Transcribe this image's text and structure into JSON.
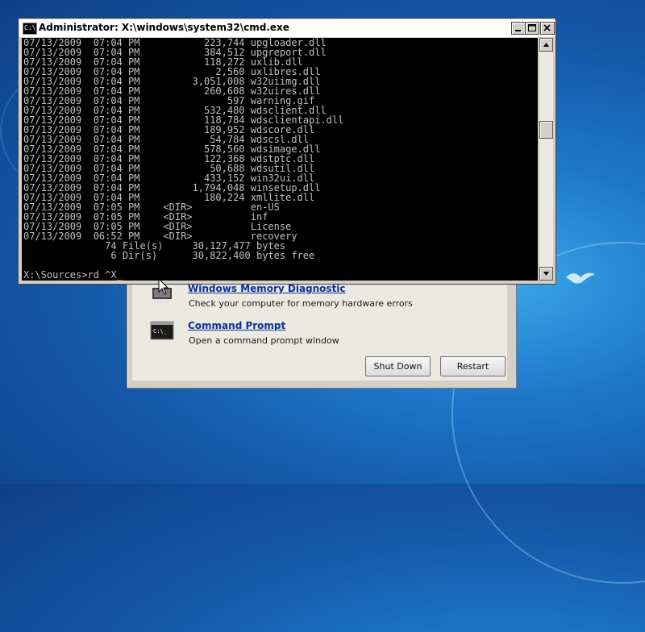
{
  "cmd": {
    "title": "Administrator: X:\\windows\\system32\\cmd.exe",
    "icon_text": "C:\\",
    "lines": [
      "07/13/2009  07:04 PM           223,744 upgloader.dll",
      "07/13/2009  07:04 PM           384,512 upgreport.dll",
      "07/13/2009  07:04 PM           118,272 uxlib.dll",
      "07/13/2009  07:04 PM             2,560 uxlibres.dll",
      "07/13/2009  07:04 PM         3,051,008 w32uiimg.dll",
      "07/13/2009  07:04 PM           260,608 w32uires.dll",
      "07/13/2009  07:04 PM               597 warning.gif",
      "07/13/2009  07:04 PM           532,480 wdsclient.dll",
      "07/13/2009  07:04 PM           118,784 wdsclientapi.dll",
      "07/13/2009  07:04 PM           189,952 wdscore.dll",
      "07/13/2009  07:04 PM            54,784 wdscsl.dll",
      "07/13/2009  07:04 PM           578,560 wdsimage.dll",
      "07/13/2009  07:04 PM           122,368 wdstptc.dll",
      "07/13/2009  07:04 PM            50,688 wdsutil.dll",
      "07/13/2009  07:04 PM           433,152 win32ui.dll",
      "07/13/2009  07:04 PM         1,794,048 winsetup.dll",
      "07/13/2009  07:04 PM           180,224 xmllite.dll",
      "07/13/2009  07:05 PM    <DIR>          en-US",
      "07/13/2009  07:05 PM    <DIR>          inf",
      "07/13/2009  07:05 PM    <DIR>          License",
      "07/13/2009  06:52 PM    <DIR>          recovery",
      "              74 File(s)     30,127,477 bytes",
      "               6 Dir(s)      30,822,400 bytes free",
      "",
      "X:\\Sources>rd ^X_"
    ]
  },
  "recovery": {
    "memory_title": "Windows Memory Diagnostic",
    "memory_desc": "Check your computer for memory hardware errors",
    "cmd_title": "Command Prompt",
    "cmd_desc": "Open a command prompt window",
    "shutdown_label": "Shut Down",
    "restart_label": "Restart"
  }
}
